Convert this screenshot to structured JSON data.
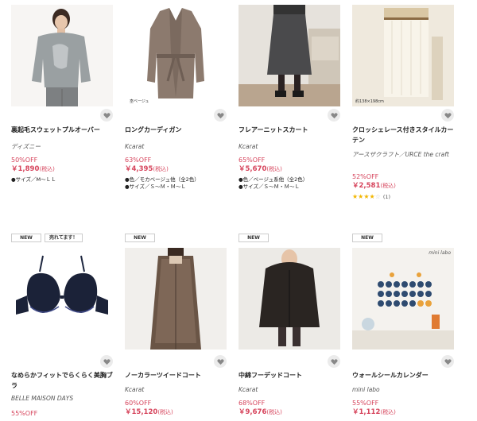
{
  "favorite_icon": "heart-icon",
  "products": [
    {
      "name": "裏起毛スウェットプルオーバー",
      "brand": "ディズニー",
      "discount": "50%OFF",
      "price": "￥1,890",
      "tax": "(税込)",
      "specs": [
        "●サイズ／M～ＬＬ"
      ],
      "tags": []
    },
    {
      "name": "ロングカーディガン",
      "brand": "Kcarat",
      "discount": "63%OFF",
      "price": "￥4,395",
      "tax": "(税込)",
      "specs": [
        "●色／モカベージュ他（全2色）",
        "●サイズ／Ｓ～Ｍ・Ｍ～Ｌ"
      ],
      "tags": [],
      "image_caption": "杢ベージュ"
    },
    {
      "name": "フレアーニットスカート",
      "brand": "Kcarat",
      "discount": "65%OFF",
      "price": "￥5,670",
      "tax": "(税込)",
      "specs": [
        "●色／ベージュ系他（全2色）",
        "●サイズ／Ｓ～Ｍ・Ｍ～Ｌ"
      ],
      "tags": []
    },
    {
      "name": "クロッシェレース付きスタイルカーテン",
      "brand": "アースザクラフト／URCE the craft",
      "discount": "52%OFF",
      "price": "￥2,581",
      "tax": "(税込)",
      "specs": [],
      "tags": [],
      "rating": 4,
      "rating_max": 5,
      "review_count": "(1)",
      "image_caption": "約138×198cm"
    },
    {
      "name": "なめらかフィットでらくらく美胸ブラ",
      "brand": "BELLE MAISON DAYS",
      "discount": "55%OFF",
      "price": "",
      "tax": "",
      "specs": [],
      "tags": [
        "NEW",
        "売れてます！"
      ]
    },
    {
      "name": "ノーカラーツイードコート",
      "brand": "Kcarat",
      "discount": "60%OFF",
      "price": "￥15,120",
      "tax": "(税込)",
      "specs": [],
      "tags": [
        "NEW"
      ]
    },
    {
      "name": "中綿フーデッドコート",
      "brand": "Kcarat",
      "discount": "68%OFF",
      "price": "￥9,676",
      "tax": "(税込)",
      "specs": [],
      "tags": [
        "NEW"
      ]
    },
    {
      "name": "ウォールシールカレンダー",
      "brand": "mini labo",
      "discount": "55%OFF",
      "price": "￥1,112",
      "tax": "(税込)",
      "specs": [],
      "tags": [
        "NEW"
      ],
      "image_caption": "mini labo"
    }
  ]
}
